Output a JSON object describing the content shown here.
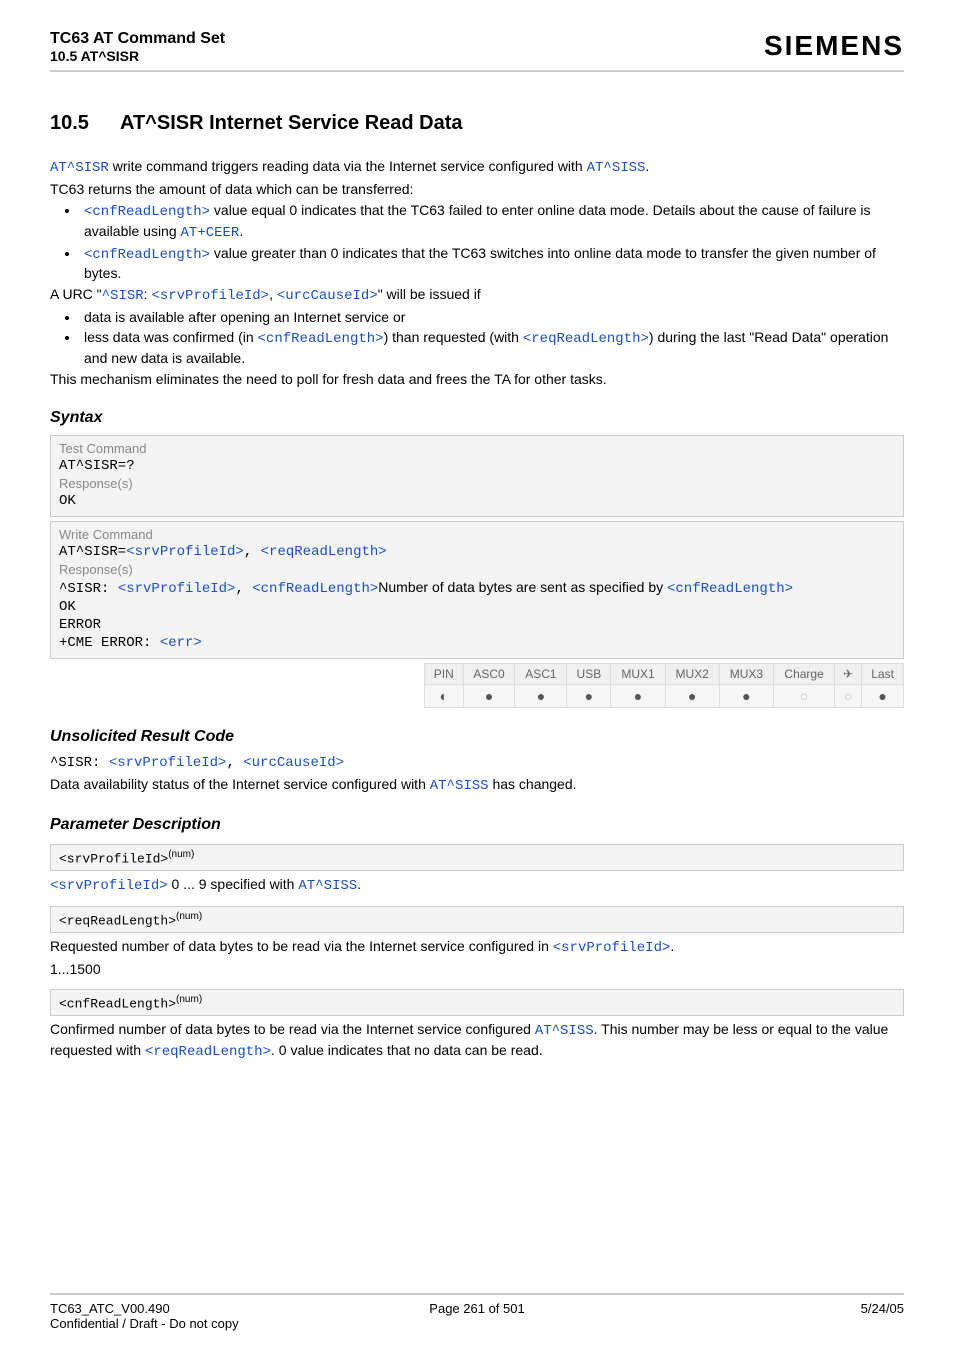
{
  "header": {
    "title1": "TC63 AT Command Set",
    "title2": "10.5 AT^SISR",
    "brand": "SIEMENS"
  },
  "section": {
    "number": "10.5",
    "title": "AT^SISR   Internet Service Read Data"
  },
  "intro": {
    "p1a": "AT^SISR",
    "p1b": " write command triggers reading data via the Internet service configured with ",
    "p1c": "AT^SISS",
    "p1d": ".",
    "p2": "TC63 returns the amount of data which can be transferred:",
    "b1a": "<cnfReadLength>",
    "b1b": " value equal 0 indicates that the TC63 failed to enter online data mode. Details about the cause of failure is available using ",
    "b1c": "AT+CEER",
    "b1d": ".",
    "b2a": "<cnfReadLength>",
    "b2b": " value greater than 0 indicates that the TC63 switches into online data mode to transfer the given number of bytes.",
    "p3a": "A URC \"",
    "p3b": "^SISR",
    "p3c": ": ",
    "p3d": "<srvProfileId>",
    "p3e": ", ",
    "p3f": "<urcCauseId>",
    "p3g": "\" will be issued if",
    "b3": "data is available after opening an Internet service or",
    "b4a": "less data was confirmed (in ",
    "b4b": "<cnfReadLength>",
    "b4c": ") than requested (with ",
    "b4d": "<reqReadLength>",
    "b4e": ") during the last \"Read Data\" operation and new data is available.",
    "p4": "This mechanism eliminates the need to poll for fresh data and frees the TA for other tasks."
  },
  "syntax_header": "Syntax",
  "syntax": {
    "testLabel": "Test Command",
    "testCmd": "AT^SISR=?",
    "respLabel1": "Response(s)",
    "ok": "OK",
    "writeLabel": "Write Command",
    "writeCmdA": "AT^SISR=",
    "writeCmdB": "<srvProfileId>",
    "writeCmdC": ", ",
    "writeCmdD": "<reqReadLength>",
    "respLabel2": "Response(s)",
    "r1a": "^SISR: ",
    "r1b": "<srvProfileId>",
    "r1c": ", ",
    "r1d": "<cnfReadLength>",
    "r1e": "Number of data bytes are sent as specified by ",
    "r1f": "<cnfReadLength>",
    "r2": "OK",
    "r3": "ERROR",
    "r4a": "+CME ERROR: ",
    "r4b": "<err>"
  },
  "caps": {
    "headers": [
      "PIN",
      "ASC0",
      "ASC1",
      "USB",
      "MUX1",
      "MUX2",
      "MUX3",
      "Charge",
      "✈",
      "Last"
    ],
    "marks": [
      "half",
      "full",
      "full",
      "full",
      "full",
      "full",
      "full",
      "empty",
      "empty",
      "full"
    ]
  },
  "urc_header": "Unsolicited Result Code",
  "urc": {
    "l1a": "^SISR: ",
    "l1b": "<srvProfileId>",
    "l1c": ", ",
    "l1d": "<urcCauseId>",
    "p1a": "Data availability status of the Internet service configured with ",
    "p1b": "AT^SISS",
    "p1c": " has changed."
  },
  "param_header": "Parameter Description",
  "params": {
    "p1name": "<srvProfileId>",
    "p1sup": "(num)",
    "p1a": "<srvProfileId>",
    "p1b": " 0 ... 9 specified with ",
    "p1c": "AT^SISS",
    "p1d": ".",
    "p2name": "<reqReadLength>",
    "p2sup": "(num)",
    "p2a": "Requested number of data bytes to be read via the Internet service configured in ",
    "p2b": "<srvProfileId>",
    "p2c": ".",
    "p2range": "1...1500",
    "p3name": "<cnfReadLength>",
    "p3sup": "(num)",
    "p3a": "Confirmed number of data bytes to be read via the Internet service configured ",
    "p3b": "AT^SISS",
    "p3c": ". This number may be less or equal to the value requested with ",
    "p3d": "<reqReadLength>",
    "p3e": ". 0 value indicates that no data can be read."
  },
  "footer": {
    "left1": "TC63_ATC_V00.490",
    "left2": "Confidential / Draft - Do not copy",
    "center": "Page 261 of 501",
    "right": "5/24/05"
  }
}
